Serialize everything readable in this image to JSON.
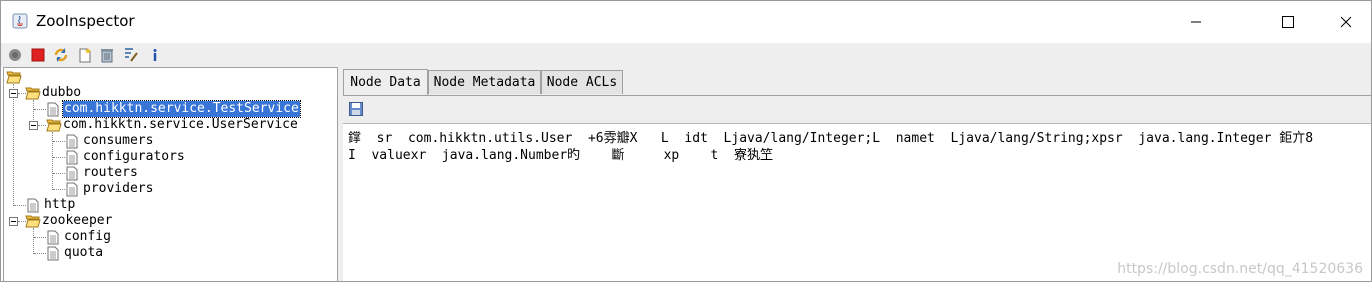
{
  "window": {
    "title": "ZooInspector",
    "minimize_icon": "minimize-icon",
    "maximize_icon": "maximize-icon",
    "close_icon": "close-icon"
  },
  "toolbar": {
    "icons": [
      "connect-icon",
      "disconnect-icon",
      "refresh-icon",
      "add-node-icon",
      "delete-node-icon",
      "node-viewers-icon",
      "about-icon"
    ]
  },
  "tree": {
    "root_icon": "folder-open-icon",
    "nodes": [
      {
        "label": "dubbo",
        "type": "folder"
      },
      {
        "label": "com.hikktn.service.TestService",
        "type": "file",
        "selected": true
      },
      {
        "label": "com.hikktn.service.UserService",
        "type": "folder"
      },
      {
        "label": "consumers",
        "type": "file"
      },
      {
        "label": "configurators",
        "type": "file"
      },
      {
        "label": "routers",
        "type": "file"
      },
      {
        "label": "providers",
        "type": "file"
      },
      {
        "label": "http",
        "type": "file"
      },
      {
        "label": "zookeeper",
        "type": "folder"
      },
      {
        "label": "config",
        "type": "file"
      },
      {
        "label": "quota",
        "type": "file"
      }
    ]
  },
  "tabs": [
    {
      "label": "Node Data",
      "active": true
    },
    {
      "label": "Node Metadata",
      "active": false
    },
    {
      "label": "Node ACLs",
      "active": false
    }
  ],
  "node_data": {
    "line1": "鐣  sr  com.hikktn.utils.User  +6雰瓣X   L  idt  Ljava/lang/Integer;L  namet  Ljava/lang/String;xpsr  java.lang.Integer 鉅亣8",
    "line2": "I  valuexr  java.lang.Number旳    斷     xp    t  寮犱笁"
  },
  "watermark": "https://blog.csdn.net/qq_41520636",
  "colors": {
    "selection": "#3875d7",
    "panel_bg": "#eeeeee",
    "folder": "#f0c040"
  }
}
